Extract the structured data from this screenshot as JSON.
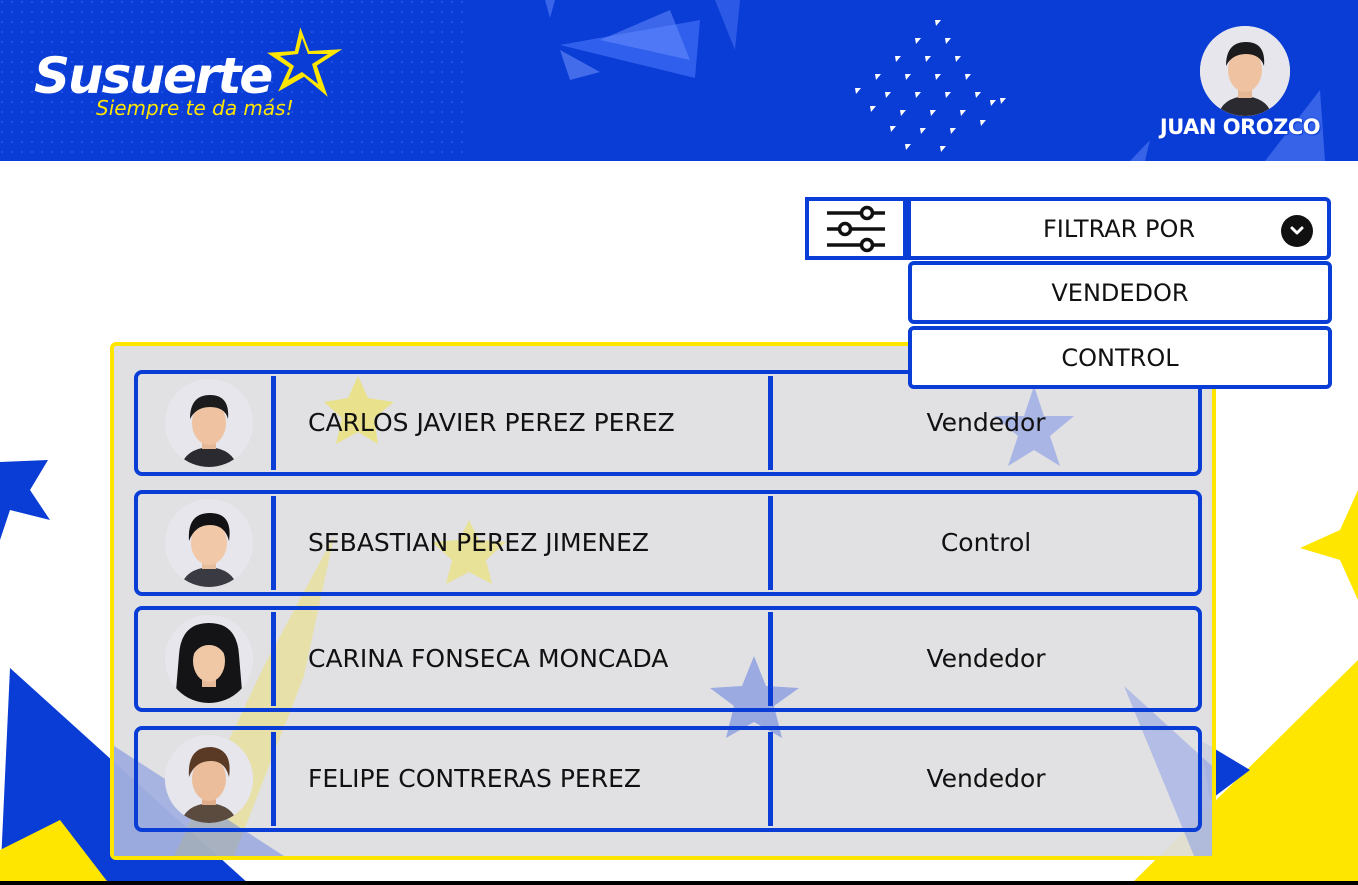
{
  "brand": {
    "name": "Susuerte",
    "tagline": "Siempre te da más!"
  },
  "user": {
    "name": "JUAN OROZCO"
  },
  "filter": {
    "label": "FILTRAR POR",
    "options": [
      "VENDEDOR",
      "CONTROL"
    ]
  },
  "people": [
    {
      "name": "CARLOS JAVIER PEREZ PEREZ",
      "role": "Vendedor"
    },
    {
      "name": "SEBASTIAN PEREZ JIMENEZ",
      "role": "Control"
    },
    {
      "name": "CARINA FONSECA MONCADA",
      "role": "Vendedor"
    },
    {
      "name": "FELIPE CONTRERAS PEREZ",
      "role": "Vendedor"
    }
  ],
  "colors": {
    "brand_blue": "#0a3cd6",
    "brand_yellow": "#ffe600",
    "panel_gray": "#dedee0"
  },
  "icons": {
    "filter": "sliders-icon",
    "dropdown": "chevron-down-icon",
    "logo": "star-icon"
  }
}
